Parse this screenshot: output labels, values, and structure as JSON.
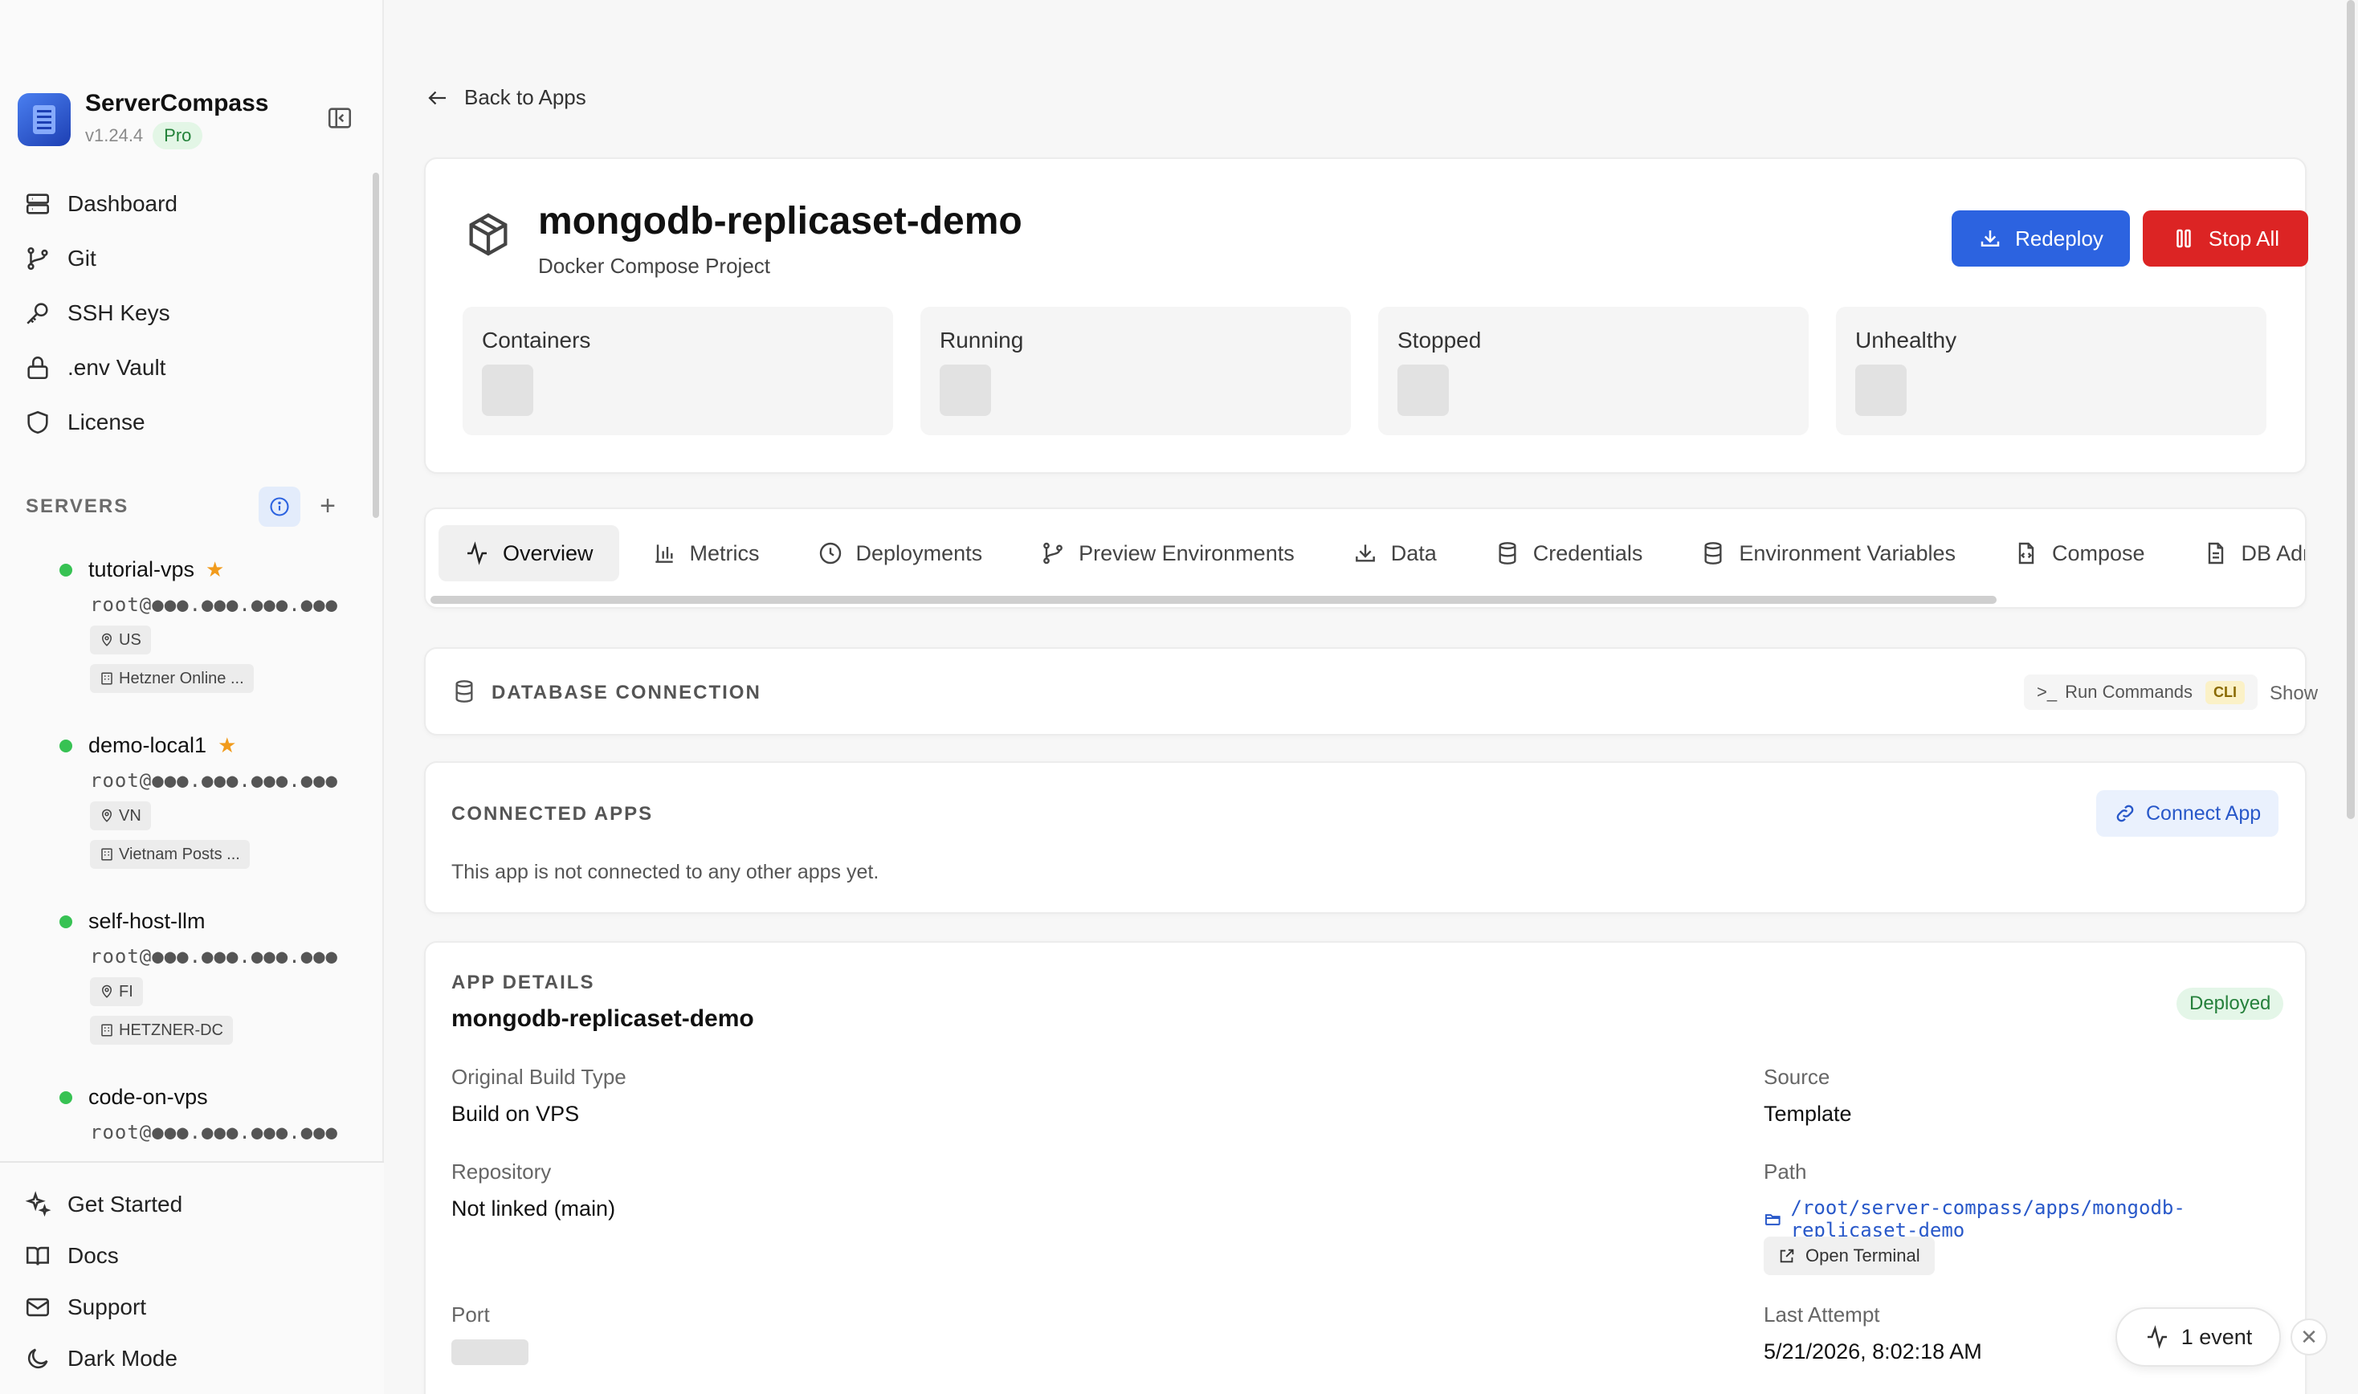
{
  "app": {
    "name": "ServerCompass",
    "version": "v1.24.4",
    "plan_badge": "Pro"
  },
  "nav": {
    "items": [
      {
        "label": "Dashboard",
        "icon": "server-stack-icon"
      },
      {
        "label": "Git",
        "icon": "git-branch-icon"
      },
      {
        "label": "SSH Keys",
        "icon": "key-icon"
      },
      {
        "label": ".env Vault",
        "icon": "lock-icon"
      },
      {
        "label": "License",
        "icon": "shield-icon"
      }
    ]
  },
  "servers": {
    "heading": "SERVERS",
    "add_symbol": "+",
    "list": [
      {
        "name": "tutorial-vps",
        "starred": true,
        "host": "root@●●●.●●●.●●●.●●●",
        "region": "US",
        "provider": "Hetzner Online ..."
      },
      {
        "name": "demo-local1",
        "starred": true,
        "host": "root@●●●.●●●.●●●.●●●",
        "region": "VN",
        "provider": "Vietnam Posts ..."
      },
      {
        "name": "self-host-llm",
        "starred": false,
        "host": "root@●●●.●●●.●●●.●●●",
        "region": "FI",
        "provider": "HETZNER-DC"
      },
      {
        "name": "code-on-vps",
        "starred": false,
        "host": "root@●●●.●●●.●●●.●●●",
        "region": "",
        "provider": ""
      }
    ],
    "status_color": "#37c253"
  },
  "bottom_nav": {
    "items": [
      {
        "label": "Get Started",
        "icon": "sparkles-icon"
      },
      {
        "label": "Docs",
        "icon": "book-open-icon"
      },
      {
        "label": "Support",
        "icon": "mail-icon"
      },
      {
        "label": "Dark Mode",
        "icon": "moon-icon"
      }
    ]
  },
  "page": {
    "back_label": "Back to Apps",
    "title": "mongodb-replicaset-demo",
    "subtitle": "Docker Compose Project",
    "redeploy_label": "Redeploy",
    "stop_label": "Stop All",
    "stats": [
      {
        "label": "Containers"
      },
      {
        "label": "Running"
      },
      {
        "label": "Stopped"
      },
      {
        "label": "Unhealthy"
      }
    ]
  },
  "tabs": [
    {
      "label": "Overview",
      "icon": "activity-icon",
      "active": true
    },
    {
      "label": "Metrics",
      "icon": "bar-chart-icon",
      "active": false
    },
    {
      "label": "Deployments",
      "icon": "clock-icon",
      "active": false
    },
    {
      "label": "Preview Environments",
      "icon": "git-branch-icon",
      "active": false
    },
    {
      "label": "Data",
      "icon": "download-icon",
      "active": false
    },
    {
      "label": "Credentials",
      "icon": "database-icon",
      "active": false
    },
    {
      "label": "Environment Variables",
      "icon": "database-icon",
      "active": false
    },
    {
      "label": "Compose",
      "icon": "file-code-icon",
      "active": false
    },
    {
      "label": "DB Admi",
      "icon": "file-text-icon",
      "active": false
    }
  ],
  "db_connection": {
    "title": "DATABASE CONNECTION",
    "run_commands_label": "Run Commands",
    "cli_badge": "CLI",
    "show_label": "Show"
  },
  "connected_apps": {
    "title": "CONNECTED APPS",
    "connect_label": "Connect App",
    "empty_text": "This app is not connected to any other apps yet."
  },
  "app_details": {
    "title": "APP DETAILS",
    "name": "mongodb-replicaset-demo",
    "status": "Deployed",
    "build_type_label": "Original Build Type",
    "build_type": "Build on VPS",
    "source_label": "Source",
    "source": "Template",
    "repo_label": "Repository",
    "repo": "Not linked (main)",
    "path_label": "Path",
    "path": "/root/server-compass/apps/mongodb-replicaset-demo",
    "terminal_label": "Open Terminal",
    "port_label": "Port",
    "last_attempt_label": "Last Attempt",
    "last_attempt": "5/21/2026, 8:02:18 AM"
  },
  "events": {
    "label": "1 event",
    "close_symbol": "✕"
  },
  "colors": {
    "primary": "#2c63e0",
    "danger": "#dc2424",
    "success": "#25803b"
  }
}
